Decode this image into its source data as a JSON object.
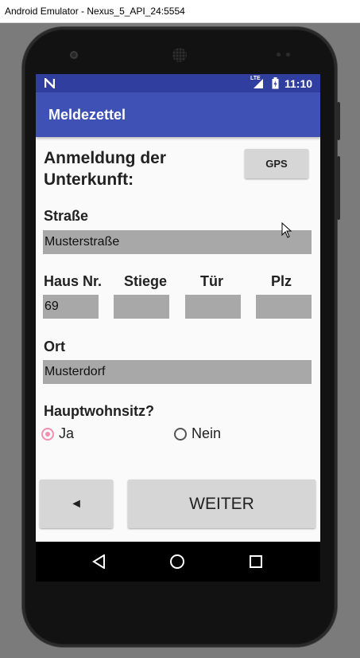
{
  "window": {
    "title": "Android Emulator - Nexus_5_API_24:5554"
  },
  "statusbar": {
    "time": "11:10",
    "network": "LTE"
  },
  "appbar": {
    "title": "Meldezettel"
  },
  "form": {
    "heading": "Anmeldung der Unterkunft:",
    "gps_label": "GPS",
    "street_label": "Straße",
    "street_value": "Musterstraße",
    "house_label": "Haus Nr.",
    "house_value": "69",
    "stair_label": "Stiege",
    "stair_value": "",
    "door_label": "Tür",
    "door_value": "",
    "zip_label": "Plz",
    "zip_value": "",
    "city_label": "Ort",
    "city_value": "Musterdorf",
    "main_residence_label": "Hauptwohnsitz?",
    "options": [
      {
        "label": "Ja",
        "checked": true
      },
      {
        "label": "Nein",
        "checked": false
      }
    ]
  },
  "buttons": {
    "back_label": "◄",
    "next_label": "WEITER"
  },
  "colors": {
    "status": "#303f9f",
    "appbar": "#3f51b5",
    "accent": "#f48fb1",
    "field": "#a8a8a8"
  }
}
